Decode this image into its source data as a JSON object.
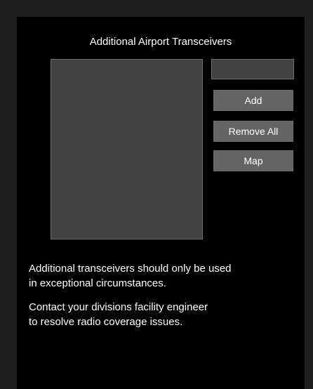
{
  "panel": {
    "title": "Additional Airport Transceivers",
    "transceiver_list": {
      "items": []
    },
    "transceiver_input": {
      "value": "",
      "placeholder": ""
    },
    "buttons": {
      "add_label": "Add",
      "remove_all_label": "Remove All",
      "map_label": "Map"
    },
    "notes": {
      "line_1a": "Additional transceivers should only be used",
      "line_1b": "in exceptional circumstances.",
      "line_2a": "Contact your divisions facility engineer",
      "line_2b": "to resolve radio coverage issues."
    }
  },
  "colors": {
    "background": "#000000",
    "frame": "#1f1f1f",
    "field_background": "#424242",
    "button_background": "#646464",
    "border": "#6d6d6d",
    "text": "#ffffff"
  }
}
